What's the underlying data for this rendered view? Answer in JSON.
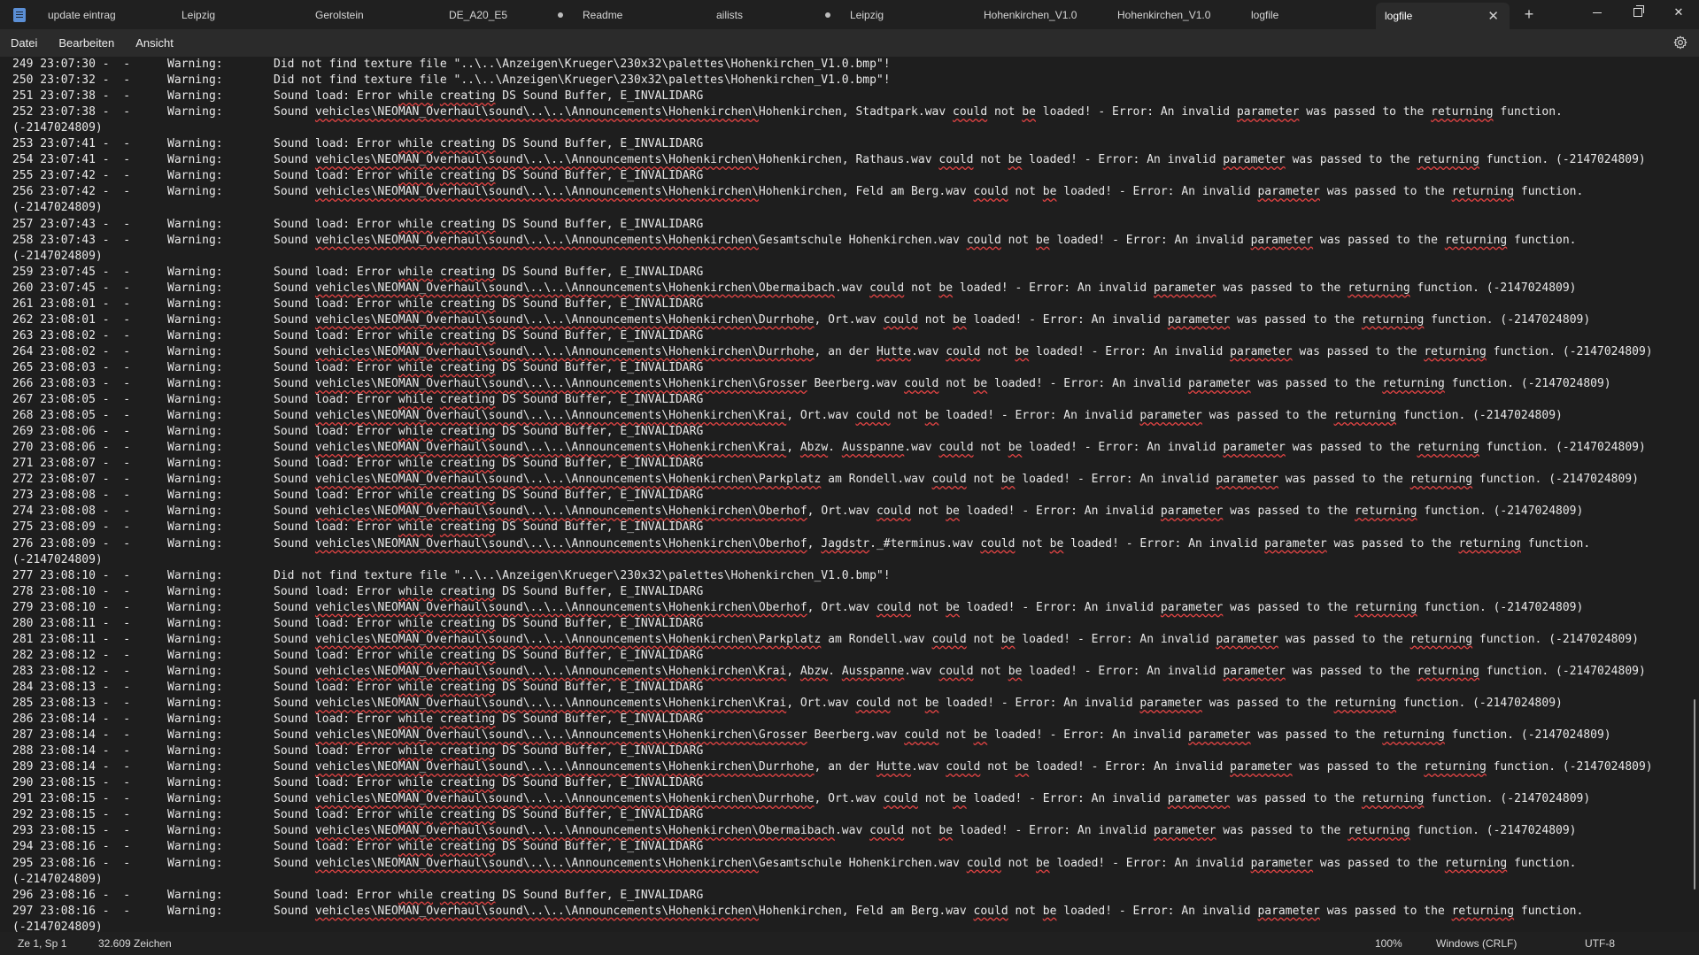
{
  "tabs": [
    {
      "label": "update eintrag",
      "dirty": false
    },
    {
      "label": "Leipzig",
      "dirty": false
    },
    {
      "label": "Gerolstein",
      "dirty": false
    },
    {
      "label": "DE_A20_E5",
      "dirty": true
    },
    {
      "label": "Readme",
      "dirty": false
    },
    {
      "label": "ailists",
      "dirty": true
    },
    {
      "label": "Leipzig",
      "dirty": false
    },
    {
      "label": "Hohenkirchen_V1.0",
      "dirty": false
    },
    {
      "label": "Hohenkirchen_V1.0",
      "dirty": false
    },
    {
      "label": "logfile",
      "dirty": false
    },
    {
      "label": "logfile",
      "dirty": false,
      "active": true
    }
  ],
  "new_tab_label": "+",
  "window_controls": {
    "close": "✕"
  },
  "menu": {
    "file": "Datei",
    "edit": "Bearbeiten",
    "view": "Ansicht"
  },
  "icons": {
    "app": "notepad-icon",
    "settings": "gear-icon"
  },
  "colors": {
    "spell_error_underline": "#e04343",
    "active_tab": "#2b2b2b"
  },
  "lines": [
    {
      "ts": "249 23:07:30 -  -",
      "lvl": "Warning:",
      "msg": "Did not find texture file \"..\\..\\Anzeigen\\Krueger\\230x32\\palettes\\Hohenkirchen_V1.0.bmp\"!"
    },
    {
      "ts": "250 23:07:32 -  -",
      "lvl": "Warning:",
      "msg": "Did not find texture file \"..\\..\\Anzeigen\\Krueger\\230x32\\palettes\\Hohenkirchen_V1.0.bmp\"!"
    },
    {
      "ts": "251 23:07:38 -  -",
      "lvl": "Warning:",
      "msg": "Sound load: Error while creating DS Sound Buffer, E_INVALIDARG"
    },
    {
      "ts": "252 23:07:38 -  -",
      "lvl": "Warning:",
      "msg": "Sound vehicles\\NEOMAN_Overhaul\\sound\\..\\..\\Announcements\\Hohenkirchen\\Hohenkirchen, Stadtpark.wav could not be loaded! - Error: An invalid parameter was passed to the returning function."
    },
    {
      "ts": "(-2147024809)",
      "lvl": "",
      "msg": ""
    },
    {
      "ts": "253 23:07:41 -  -",
      "lvl": "Warning:",
      "msg": "Sound load: Error while creating DS Sound Buffer, E_INVALIDARG"
    },
    {
      "ts": "254 23:07:41 -  -",
      "lvl": "Warning:",
      "msg": "Sound vehicles\\NEOMAN_Overhaul\\sound\\..\\..\\Announcements\\Hohenkirchen\\Hohenkirchen, Rathaus.wav could not be loaded! - Error: An invalid parameter was passed to the returning function. (-2147024809)"
    },
    {
      "ts": "255 23:07:42 -  -",
      "lvl": "Warning:",
      "msg": "Sound load: Error while creating DS Sound Buffer, E_INVALIDARG"
    },
    {
      "ts": "256 23:07:42 -  -",
      "lvl": "Warning:",
      "msg": "Sound vehicles\\NEOMAN_Overhaul\\sound\\..\\..\\Announcements\\Hohenkirchen\\Hohenkirchen, Feld am Berg.wav could not be loaded! - Error: An invalid parameter was passed to the returning function."
    },
    {
      "ts": "(-2147024809)",
      "lvl": "",
      "msg": ""
    },
    {
      "ts": "257 23:07:43 -  -",
      "lvl": "Warning:",
      "msg": "Sound load: Error while creating DS Sound Buffer, E_INVALIDARG"
    },
    {
      "ts": "258 23:07:43 -  -",
      "lvl": "Warning:",
      "msg": "Sound vehicles\\NEOMAN_Overhaul\\sound\\..\\..\\Announcements\\Hohenkirchen\\Gesamtschule Hohenkirchen.wav could not be loaded! - Error: An invalid parameter was passed to the returning function."
    },
    {
      "ts": "(-2147024809)",
      "lvl": "",
      "msg": ""
    },
    {
      "ts": "259 23:07:45 -  -",
      "lvl": "Warning:",
      "msg": "Sound load: Error while creating DS Sound Buffer, E_INVALIDARG"
    },
    {
      "ts": "260 23:07:45 -  -",
      "lvl": "Warning:",
      "msg": "Sound vehicles\\NEOMAN_Overhaul\\sound\\..\\..\\Announcements\\Hohenkirchen\\Obermaibach.wav could not be loaded! - Error: An invalid parameter was passed to the returning function. (-2147024809)"
    },
    {
      "ts": "261 23:08:01 -  -",
      "lvl": "Warning:",
      "msg": "Sound load: Error while creating DS Sound Buffer, E_INVALIDARG"
    },
    {
      "ts": "262 23:08:01 -  -",
      "lvl": "Warning:",
      "msg": "Sound vehicles\\NEOMAN_Overhaul\\sound\\..\\..\\Announcements\\Hohenkirchen\\Durrhohe, Ort.wav could not be loaded! - Error: An invalid parameter was passed to the returning function. (-2147024809)"
    },
    {
      "ts": "263 23:08:02 -  -",
      "lvl": "Warning:",
      "msg": "Sound load: Error while creating DS Sound Buffer, E_INVALIDARG"
    },
    {
      "ts": "264 23:08:02 -  -",
      "lvl": "Warning:",
      "msg": "Sound vehicles\\NEOMAN_Overhaul\\sound\\..\\..\\Announcements\\Hohenkirchen\\Durrhohe, an der Hutte.wav could not be loaded! - Error: An invalid parameter was passed to the returning function. (-2147024809)"
    },
    {
      "ts": "265 23:08:03 -  -",
      "lvl": "Warning:",
      "msg": "Sound load: Error while creating DS Sound Buffer, E_INVALIDARG"
    },
    {
      "ts": "266 23:08:03 -  -",
      "lvl": "Warning:",
      "msg": "Sound vehicles\\NEOMAN_Overhaul\\sound\\..\\..\\Announcements\\Hohenkirchen\\Grosser Beerberg.wav could not be loaded! - Error: An invalid parameter was passed to the returning function. (-2147024809)"
    },
    {
      "ts": "267 23:08:05 -  -",
      "lvl": "Warning:",
      "msg": "Sound load: Error while creating DS Sound Buffer, E_INVALIDARG"
    },
    {
      "ts": "268 23:08:05 -  -",
      "lvl": "Warning:",
      "msg": "Sound vehicles\\NEOMAN_Overhaul\\sound\\..\\..\\Announcements\\Hohenkirchen\\Krai, Ort.wav could not be loaded! - Error: An invalid parameter was passed to the returning function. (-2147024809)"
    },
    {
      "ts": "269 23:08:06 -  -",
      "lvl": "Warning:",
      "msg": "Sound load: Error while creating DS Sound Buffer, E_INVALIDARG"
    },
    {
      "ts": "270 23:08:06 -  -",
      "lvl": "Warning:",
      "msg": "Sound vehicles\\NEOMAN_Overhaul\\sound\\..\\..\\Announcements\\Hohenkirchen\\Krai, Abzw. Ausspanne.wav could not be loaded! - Error: An invalid parameter was passed to the returning function. (-2147024809)"
    },
    {
      "ts": "271 23:08:07 -  -",
      "lvl": "Warning:",
      "msg": "Sound load: Error while creating DS Sound Buffer, E_INVALIDARG"
    },
    {
      "ts": "272 23:08:07 -  -",
      "lvl": "Warning:",
      "msg": "Sound vehicles\\NEOMAN_Overhaul\\sound\\..\\..\\Announcements\\Hohenkirchen\\Parkplatz am Rondell.wav could not be loaded! - Error: An invalid parameter was passed to the returning function. (-2147024809)"
    },
    {
      "ts": "273 23:08:08 -  -",
      "lvl": "Warning:",
      "msg": "Sound load: Error while creating DS Sound Buffer, E_INVALIDARG"
    },
    {
      "ts": "274 23:08:08 -  -",
      "lvl": "Warning:",
      "msg": "Sound vehicles\\NEOMAN_Overhaul\\sound\\..\\..\\Announcements\\Hohenkirchen\\Oberhof, Ort.wav could not be loaded! - Error: An invalid parameter was passed to the returning function. (-2147024809)"
    },
    {
      "ts": "275 23:08:09 -  -",
      "lvl": "Warning:",
      "msg": "Sound load: Error while creating DS Sound Buffer, E_INVALIDARG"
    },
    {
      "ts": "276 23:08:09 -  -",
      "lvl": "Warning:",
      "msg": "Sound vehicles\\NEOMAN_Overhaul\\sound\\..\\..\\Announcements\\Hohenkirchen\\Oberhof, Jagdstr._#terminus.wav could not be loaded! - Error: An invalid parameter was passed to the returning function."
    },
    {
      "ts": "(-2147024809)",
      "lvl": "",
      "msg": ""
    },
    {
      "ts": "277 23:08:10 -  -",
      "lvl": "Warning:",
      "msg": "Did not find texture file \"..\\..\\Anzeigen\\Krueger\\230x32\\palettes\\Hohenkirchen_V1.0.bmp\"!"
    },
    {
      "ts": "278 23:08:10 -  -",
      "lvl": "Warning:",
      "msg": "Sound load: Error while creating DS Sound Buffer, E_INVALIDARG"
    },
    {
      "ts": "279 23:08:10 -  -",
      "lvl": "Warning:",
      "msg": "Sound vehicles\\NEOMAN_Overhaul\\sound\\..\\..\\Announcements\\Hohenkirchen\\Oberhof, Ort.wav could not be loaded! - Error: An invalid parameter was passed to the returning function. (-2147024809)"
    },
    {
      "ts": "280 23:08:11 -  -",
      "lvl": "Warning:",
      "msg": "Sound load: Error while creating DS Sound Buffer, E_INVALIDARG"
    },
    {
      "ts": "281 23:08:11 -  -",
      "lvl": "Warning:",
      "msg": "Sound vehicles\\NEOMAN_Overhaul\\sound\\..\\..\\Announcements\\Hohenkirchen\\Parkplatz am Rondell.wav could not be loaded! - Error: An invalid parameter was passed to the returning function. (-2147024809)"
    },
    {
      "ts": "282 23:08:12 -  -",
      "lvl": "Warning:",
      "msg": "Sound load: Error while creating DS Sound Buffer, E_INVALIDARG"
    },
    {
      "ts": "283 23:08:12 -  -",
      "lvl": "Warning:",
      "msg": "Sound vehicles\\NEOMAN_Overhaul\\sound\\..\\..\\Announcements\\Hohenkirchen\\Krai, Abzw. Ausspanne.wav could not be loaded! - Error: An invalid parameter was passed to the returning function. (-2147024809)"
    },
    {
      "ts": "284 23:08:13 -  -",
      "lvl": "Warning:",
      "msg": "Sound load: Error while creating DS Sound Buffer, E_INVALIDARG"
    },
    {
      "ts": "285 23:08:13 -  -",
      "lvl": "Warning:",
      "msg": "Sound vehicles\\NEOMAN_Overhaul\\sound\\..\\..\\Announcements\\Hohenkirchen\\Krai, Ort.wav could not be loaded! - Error: An invalid parameter was passed to the returning function. (-2147024809)"
    },
    {
      "ts": "286 23:08:14 -  -",
      "lvl": "Warning:",
      "msg": "Sound load: Error while creating DS Sound Buffer, E_INVALIDARG"
    },
    {
      "ts": "287 23:08:14 -  -",
      "lvl": "Warning:",
      "msg": "Sound vehicles\\NEOMAN_Overhaul\\sound\\..\\..\\Announcements\\Hohenkirchen\\Grosser Beerberg.wav could not be loaded! - Error: An invalid parameter was passed to the returning function. (-2147024809)"
    },
    {
      "ts": "288 23:08:14 -  -",
      "lvl": "Warning:",
      "msg": "Sound load: Error while creating DS Sound Buffer, E_INVALIDARG"
    },
    {
      "ts": "289 23:08:14 -  -",
      "lvl": "Warning:",
      "msg": "Sound vehicles\\NEOMAN_Overhaul\\sound\\..\\..\\Announcements\\Hohenkirchen\\Durrhohe, an der Hutte.wav could not be loaded! - Error: An invalid parameter was passed to the returning function. (-2147024809)"
    },
    {
      "ts": "290 23:08:15 -  -",
      "lvl": "Warning:",
      "msg": "Sound load: Error while creating DS Sound Buffer, E_INVALIDARG"
    },
    {
      "ts": "291 23:08:15 -  -",
      "lvl": "Warning:",
      "msg": "Sound vehicles\\NEOMAN_Overhaul\\sound\\..\\..\\Announcements\\Hohenkirchen\\Durrhohe, Ort.wav could not be loaded! - Error: An invalid parameter was passed to the returning function. (-2147024809)"
    },
    {
      "ts": "292 23:08:15 -  -",
      "lvl": "Warning:",
      "msg": "Sound load: Error while creating DS Sound Buffer, E_INVALIDARG"
    },
    {
      "ts": "293 23:08:15 -  -",
      "lvl": "Warning:",
      "msg": "Sound vehicles\\NEOMAN_Overhaul\\sound\\..\\..\\Announcements\\Hohenkirchen\\Obermaibach.wav could not be loaded! - Error: An invalid parameter was passed to the returning function. (-2147024809)"
    },
    {
      "ts": "294 23:08:16 -  -",
      "lvl": "Warning:",
      "msg": "Sound load: Error while creating DS Sound Buffer, E_INVALIDARG"
    },
    {
      "ts": "295 23:08:16 -  -",
      "lvl": "Warning:",
      "msg": "Sound vehicles\\NEOMAN_Overhaul\\sound\\..\\..\\Announcements\\Hohenkirchen\\Gesamtschule Hohenkirchen.wav could not be loaded! - Error: An invalid parameter was passed to the returning function."
    },
    {
      "ts": "(-2147024809)",
      "lvl": "",
      "msg": ""
    },
    {
      "ts": "296 23:08:16 -  -",
      "lvl": "Warning:",
      "msg": "Sound load: Error while creating DS Sound Buffer, E_INVALIDARG"
    },
    {
      "ts": "297 23:08:16 -  -",
      "lvl": "Warning:",
      "msg": "Sound vehicles\\NEOMAN_Overhaul\\sound\\..\\..\\Announcements\\Hohenkirchen\\Hohenkirchen, Feld am Berg.wav could not be loaded! - Error: An invalid parameter was passed to the returning function."
    },
    {
      "ts": "(-2147024809)",
      "lvl": "",
      "msg": ""
    }
  ],
  "status": {
    "cursor": "Ze 1, Sp 1",
    "chars": "32.609 Zeichen",
    "zoom": "100%",
    "line_ending": "Windows (CRLF)",
    "encoding": "UTF-8"
  }
}
